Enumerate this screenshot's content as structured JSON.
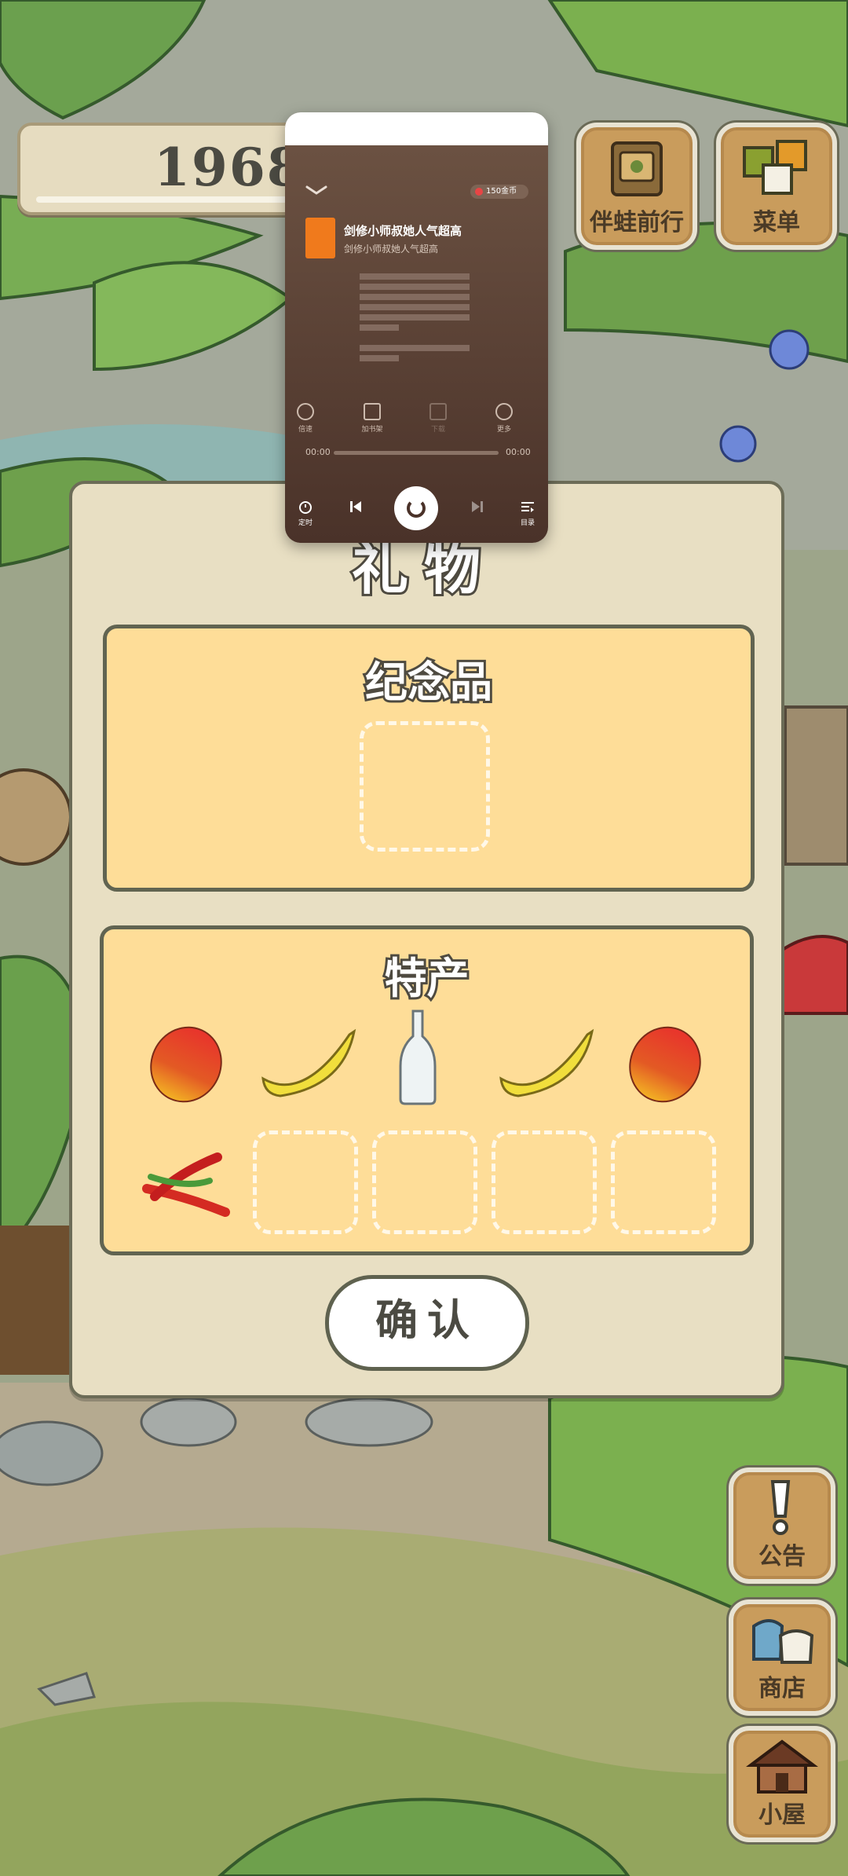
{
  "counter": {
    "value": "1968"
  },
  "top_buttons": [
    {
      "label": "伴蛙前行",
      "icon": "map-book-icon"
    },
    {
      "label": "菜单",
      "icon": "menu-cards-icon"
    }
  ],
  "music_player": {
    "coin_badge": "150金币",
    "song_title": "剑修小师叔她人气超高",
    "song_subtitle": "剑修小师叔她人气超高",
    "controls": [
      {
        "label": "倍速",
        "icon": "speed-icon"
      },
      {
        "label": "加书架",
        "icon": "add-shelf-icon"
      },
      {
        "label": "下载",
        "icon": "download-icon"
      },
      {
        "label": "更多",
        "icon": "more-icon"
      }
    ],
    "time_current": "00:00",
    "time_total": "00:00",
    "bottom": [
      {
        "label": "定时",
        "icon": "timer-icon"
      },
      {
        "label": "目录",
        "icon": "playlist-icon"
      }
    ]
  },
  "gift_dialog": {
    "title": "礼物",
    "souvenir": {
      "title": "纪念品"
    },
    "specialty": {
      "title": "特产",
      "items": [
        "mango",
        "banana",
        "bottle",
        "banana",
        "mango",
        "chili-peppers"
      ]
    },
    "confirm_label": "确认"
  },
  "side_buttons": [
    {
      "label": "公告",
      "icon": "exclamation-icon"
    },
    {
      "label": "商店",
      "icon": "shop-bags-icon"
    },
    {
      "label": "小屋",
      "icon": "house-icon"
    }
  ]
}
